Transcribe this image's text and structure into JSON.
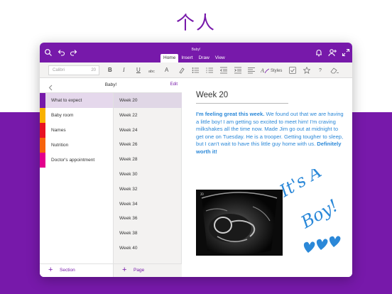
{
  "headline": "个人",
  "colors": {
    "brand": "#7719aa",
    "ink": "#2b88d8"
  },
  "window": {
    "doc_title": "Baby!",
    "tabs": [
      {
        "label": "Home",
        "active": true
      },
      {
        "label": "Insert",
        "active": false
      },
      {
        "label": "Draw",
        "active": false
      },
      {
        "label": "View",
        "active": false
      }
    ],
    "icons": [
      "search-icon",
      "undo-icon",
      "redo-icon",
      "bell-icon",
      "add-person-icon",
      "expand-icon"
    ]
  },
  "ribbon": {
    "font_name": "Calibri",
    "font_size": "20",
    "bold": "B",
    "italic": "I",
    "underline": "U",
    "strikethrough": "abc",
    "font_color": "A",
    "styles_label": "Styles"
  },
  "notebook": {
    "title": "Baby!",
    "edit": "Edit"
  },
  "sections": [
    {
      "label": "What to expect",
      "color": "#7719aa",
      "selected": true
    },
    {
      "label": "Baby room",
      "color": "#f9b100",
      "selected": false
    },
    {
      "label": "Names",
      "color": "#e81123",
      "selected": false
    },
    {
      "label": "Nutrition",
      "color": "#f7630c",
      "selected": false
    },
    {
      "label": "Doctor's appointment",
      "color": "#e3008c",
      "selected": false
    }
  ],
  "pages": [
    "Week 20",
    "Week 22",
    "Week 24",
    "Week 26",
    "Week 28",
    "Week 30",
    "Week 32",
    "Week 34",
    "Week 36",
    "Week 38",
    "Week 40"
  ],
  "add_section": "Section",
  "add_page": "Page",
  "note": {
    "title": "Week 20",
    "intro_bold": "I'm feeling great this week.",
    "body": " We found out that we are having a little boy! I am getting so excited to meet him! I'm craving milkshakes all the time now. Made Jim go out at midnight to get one on Tuesday. He is a trooper. Getting tougher to sleep, but I can't wait to have this little guy home with us. ",
    "closing_bold": "Definitely worth it!",
    "handwriting_line1": "It's A",
    "handwriting_line2": "Boy!"
  }
}
